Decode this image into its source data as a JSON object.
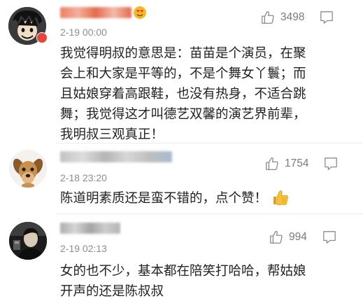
{
  "comments": [
    {
      "time": "2-19 00:00",
      "likes": "3498",
      "text": "我觉得明叔的意思是：苗苗是个演员，在聚会上和大家是平等的，不是个舞女丫鬟；而且姑娘穿着高跟鞋，也没有热身，不适合跳舞；我觉得这才叫德艺双馨的演艺界前辈，我明叔三观真正！",
      "lines": [
        "我觉得明叔的意思是：苗苗是个演员，在聚",
        "会上和大家是平等的，不是个舞女丫鬟；而",
        "且姑娘穿着高跟鞋，也没有热身，不适合跳",
        "舞；我觉得这才叫德艺双馨的演艺界前辈，",
        "我明叔三观真正！"
      ],
      "name_color": "#e0522e",
      "avatar_icon": "anime-character-avatar"
    },
    {
      "time": "2-18 23:20",
      "likes": "1754",
      "text": "陈道明素质还是蛮不错的，点个赞！",
      "emoji": "thumbs-up-emoji",
      "name_color": "#9a9a9a",
      "avatar_icon": "puppy-avatar"
    },
    {
      "time": "2-19 02:13",
      "likes": "994",
      "text": "女的也不少，基本都在陪笑打哈哈，帮姑娘开声的还是陈叔叔",
      "lines": [
        "女的也不少，基本都在陪笑打哈哈，帮姑娘",
        "开声的还是陈叔叔"
      ],
      "name_color": "#9a9a9a",
      "avatar_icon": "person-photo-avatar"
    }
  ],
  "colors": {
    "text": "#222222",
    "meta": "#8d8d8d",
    "icon": "#8a8a8a",
    "vip_badge": "#e4463b"
  }
}
